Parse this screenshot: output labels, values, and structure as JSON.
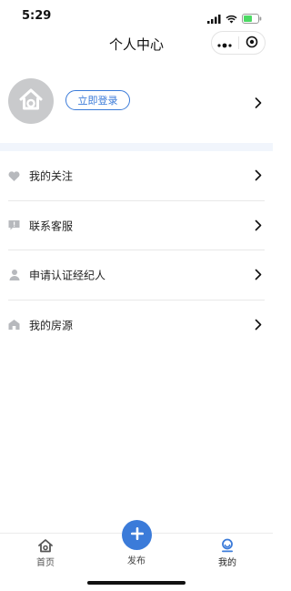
{
  "status_bar": {
    "time": "5:29",
    "icons": [
      "signal-icon",
      "wifi-icon",
      "battery-icon"
    ]
  },
  "nav": {
    "title": "个人中心",
    "capsule": [
      "more-icon",
      "close-icon"
    ]
  },
  "profile": {
    "avatar_icon": "house-logo-icon",
    "login_label": "立即登录",
    "arrow_icon": "chevron-right-icon"
  },
  "menu": {
    "items": [
      {
        "label": "我的关注",
        "icon": "heart-icon"
      },
      {
        "label": "联系客服",
        "icon": "message-alert-icon"
      },
      {
        "label": "申请认证经纪人",
        "icon": "person-icon"
      },
      {
        "label": "我的房源",
        "icon": "house-icon"
      }
    ]
  },
  "tab_bar": {
    "tabs": [
      {
        "label": "首页",
        "icon": "home-icon"
      },
      {
        "label": "发布",
        "icon": "plus-icon"
      },
      {
        "label": "我的",
        "icon": "profile-icon"
      }
    ],
    "active": "我的"
  },
  "colors": {
    "accent": "#3b7bd9",
    "band": "#f1f5fc",
    "icon_gray": "#b7b9bd",
    "avatar_gray": "#c9cacc"
  }
}
